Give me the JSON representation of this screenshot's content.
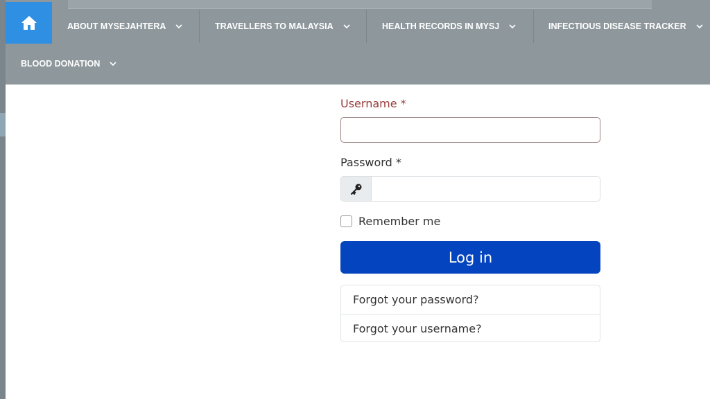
{
  "nav": {
    "items": [
      {
        "label": "ABOUT MYSEJAHTERA"
      },
      {
        "label": "TRAVELLERS TO MALAYSIA"
      },
      {
        "label": "HEALTH RECORDS IN MYSJ"
      },
      {
        "label": "INFECTIOUS DISEASE TRACKER"
      },
      {
        "label": "BLOOD DONATION"
      }
    ],
    "home_icon": "home-icon",
    "chevron_icon": "chevron-down-icon",
    "colors": {
      "bar": "#8e989c",
      "home": "#2f8fe3",
      "text": "#ffffff"
    }
  },
  "form": {
    "username_label": "Username *",
    "username_value": "",
    "password_label": "Password *",
    "password_value": "",
    "password_icon": "key-icon",
    "remember_label": "Remember me",
    "remember_checked": false,
    "login_label": "Log in",
    "links": [
      {
        "label": "Forgot your password?"
      },
      {
        "label": "Forgot your username?"
      }
    ],
    "colors": {
      "button": "#0444bf",
      "username_label": "#9a3b3b"
    }
  }
}
